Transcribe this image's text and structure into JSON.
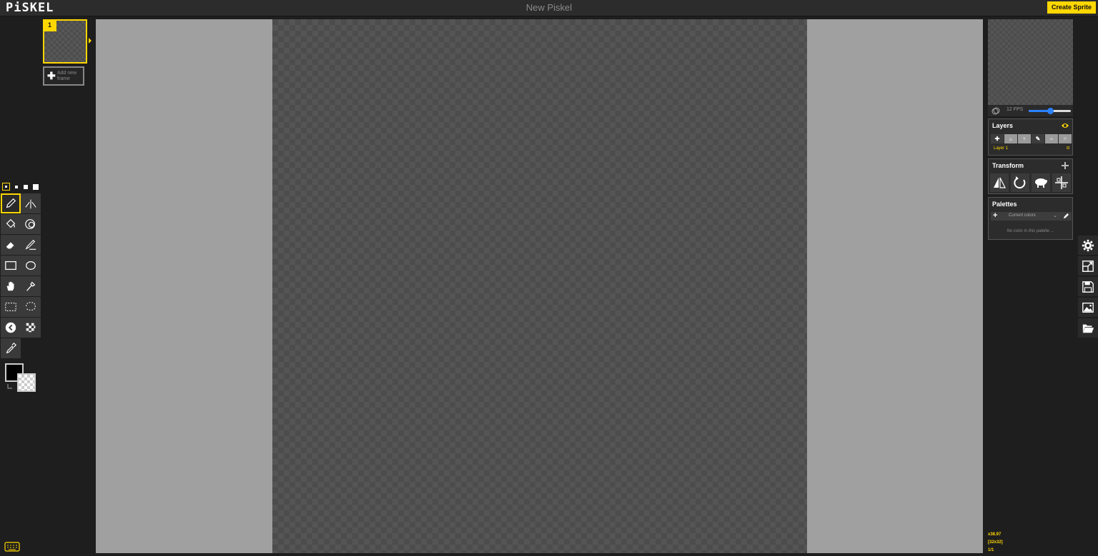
{
  "app": {
    "logo": "PiSKEL",
    "title": "New Piskel",
    "create_button": "Create Sprite"
  },
  "frames": {
    "items": [
      {
        "number": "1"
      }
    ],
    "add_label": "Add new frame"
  },
  "tools": {
    "pen_sizes": [
      1,
      2,
      3,
      4
    ],
    "selected_pen_size": 1,
    "items": [
      {
        "name": "pen-tool",
        "icon": "pencil-icon",
        "active": true
      },
      {
        "name": "vertical-mirror-pen-tool",
        "icon": "mirror-pen-icon"
      },
      {
        "name": "paint-bucket-tool",
        "icon": "bucket-icon"
      },
      {
        "name": "paint-all-same-color-tool",
        "icon": "color-swap-icon"
      },
      {
        "name": "eraser-tool",
        "icon": "eraser-icon"
      },
      {
        "name": "stroke-tool",
        "icon": "line-icon"
      },
      {
        "name": "rectangle-tool",
        "icon": "rectangle-icon"
      },
      {
        "name": "circle-tool",
        "icon": "circle-icon"
      },
      {
        "name": "move-tool",
        "icon": "hand-icon"
      },
      {
        "name": "shape-selection-tool",
        "icon": "magic-wand-icon"
      },
      {
        "name": "rectangle-selection-tool",
        "icon": "rect-select-icon"
      },
      {
        "name": "lasso-selection-tool",
        "icon": "lasso-icon"
      },
      {
        "name": "lighten-tool",
        "icon": "lighten-icon"
      },
      {
        "name": "dithering-tool",
        "icon": "checker-icon"
      },
      {
        "name": "color-picker-tool",
        "icon": "eyedropper-icon"
      }
    ],
    "primary_color": "#000000",
    "secondary_color": "transparent"
  },
  "preview": {
    "fps_label": "12 FPS",
    "fps_value": 12,
    "fps_max": 24
  },
  "layers": {
    "title": "Layers",
    "buttons": [
      "add",
      "move-up",
      "move-down",
      "edit",
      "merge",
      "delete"
    ],
    "items": [
      {
        "name": "Layer 1",
        "alpha": "α"
      }
    ]
  },
  "transform": {
    "title": "Transform"
  },
  "palettes": {
    "title": "Palettes",
    "selected": "Current colors",
    "empty_text": "No color in this palette ..."
  },
  "status": {
    "zoom": "x38.97",
    "size": "[32x32]",
    "frame": "1/1"
  },
  "colors": {
    "accent": "#ffd700",
    "background": "#1e1e1e",
    "stage": "#a0a0a0",
    "slider": "#2a82ff"
  }
}
